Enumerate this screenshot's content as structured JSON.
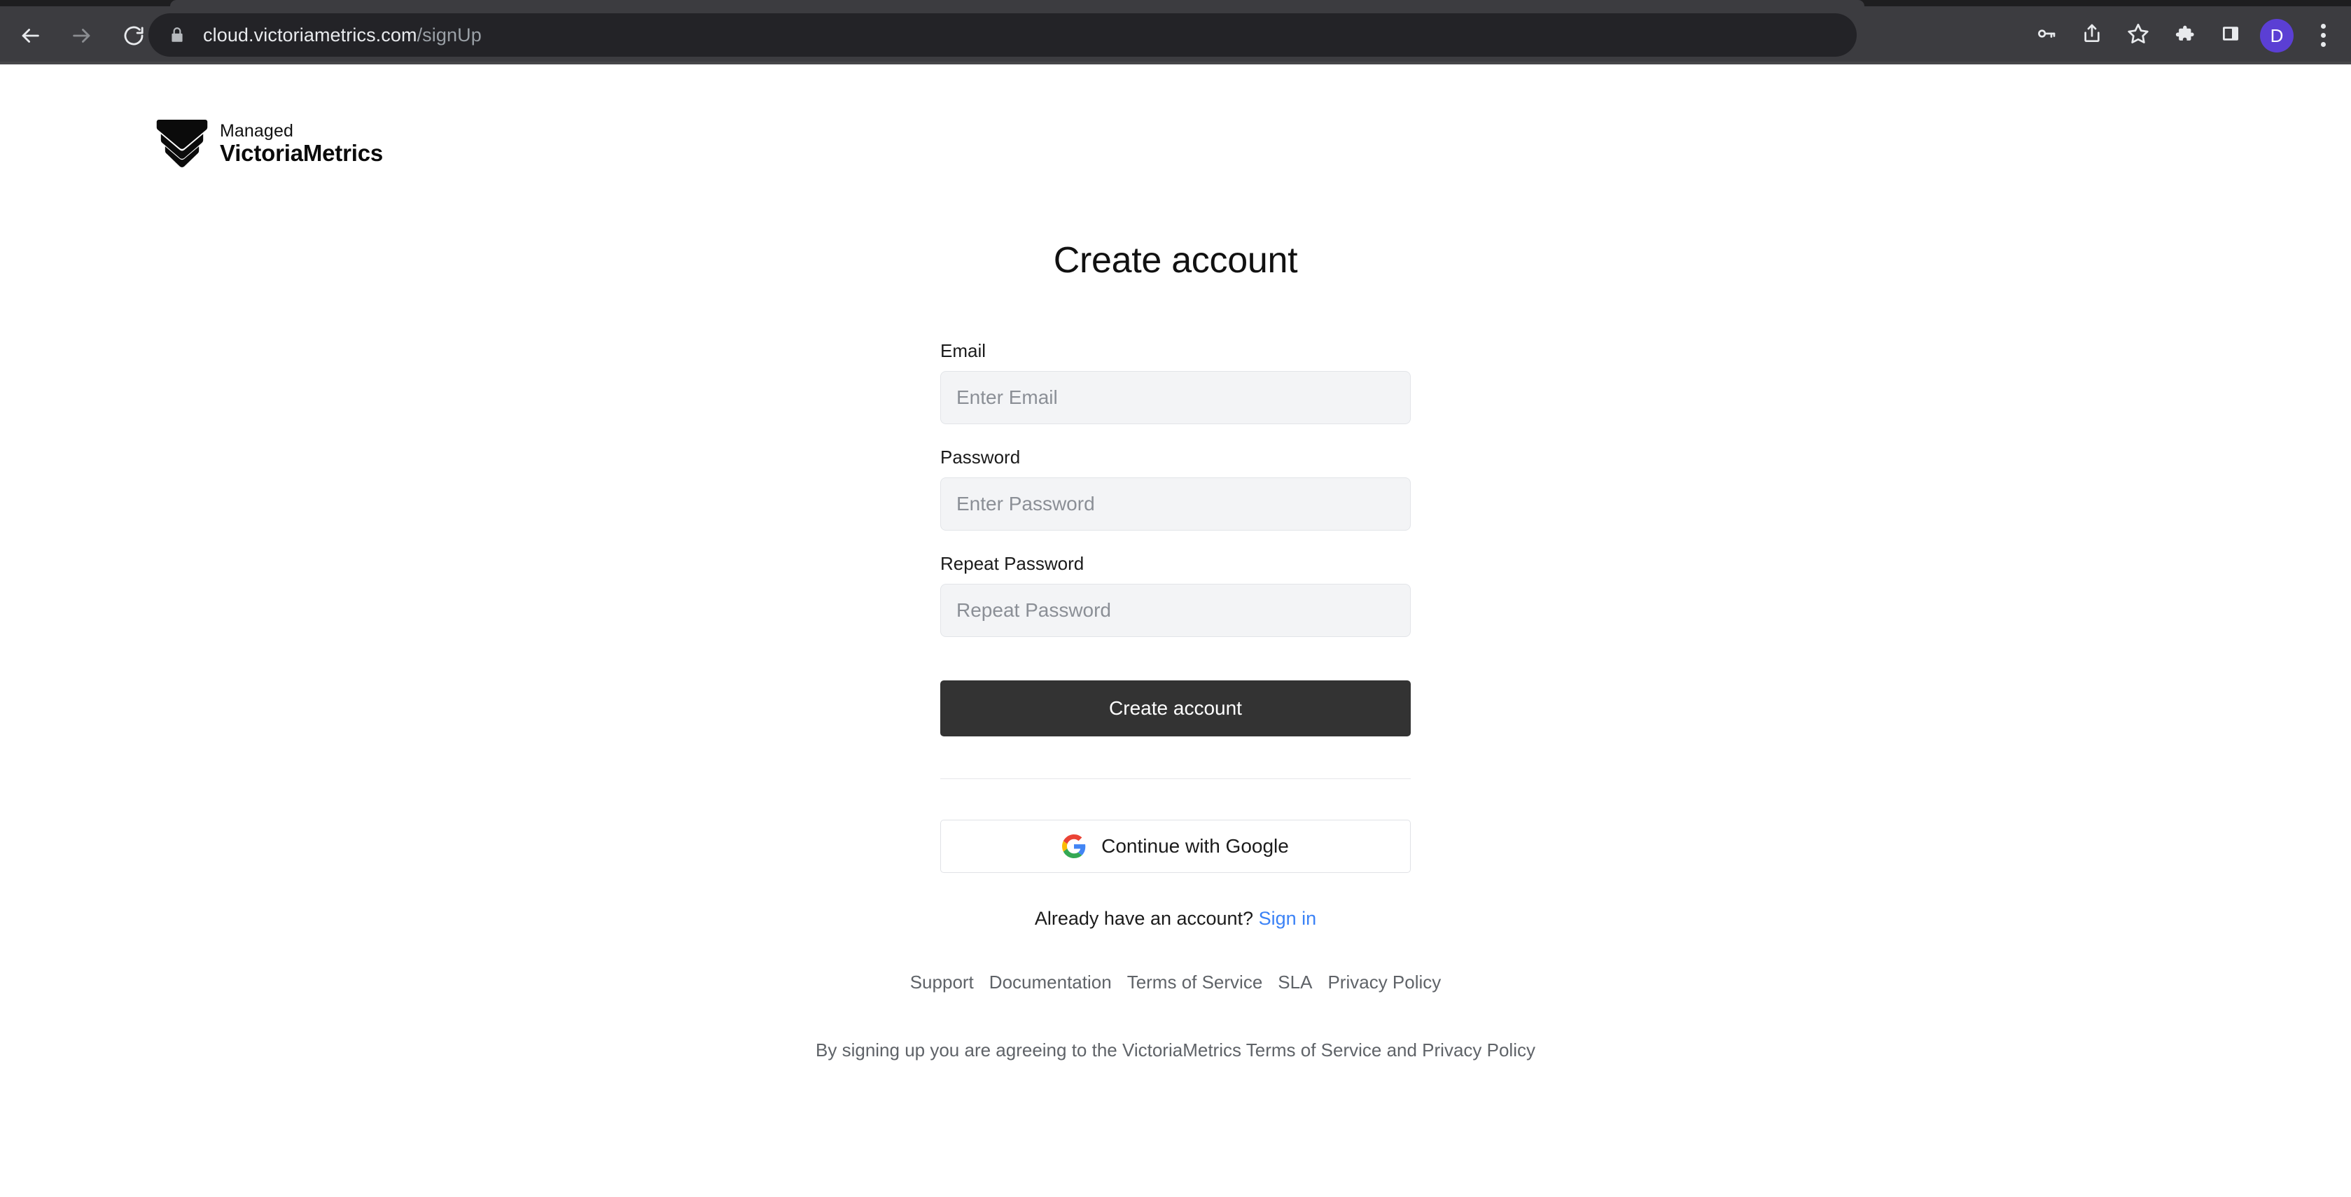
{
  "browser": {
    "back_icon": "back-arrow-icon",
    "forward_icon": "forward-arrow-icon",
    "reload_icon": "reload-icon",
    "lock_icon": "lock-icon",
    "url_host": "cloud.victoriametrics.com",
    "url_path": "/signUp",
    "actions": [
      {
        "name": "password-manager-icon",
        "label": "Passwords"
      },
      {
        "name": "share-icon",
        "label": "Share"
      },
      {
        "name": "bookmark-star-icon",
        "label": "Bookmark"
      },
      {
        "name": "extensions-puzzle-icon",
        "label": "Extensions"
      },
      {
        "name": "side-panel-icon",
        "label": "Side panel"
      }
    ],
    "avatar_initial": "D",
    "menu_icon": "three-dot-menu-icon",
    "colors": {
      "toolbar": "#3c3c40",
      "omnibox": "#232327",
      "tabstrip": "#1e1e20",
      "avatar": "#5b3fd4",
      "url_text": "#e8eaed",
      "url_path_text": "#9aa0a6"
    }
  },
  "brand": {
    "mark": "victoriametrics-chevron-logo",
    "line1": "Managed",
    "line2": "VictoriaMetrics"
  },
  "page": {
    "title": "Create account"
  },
  "form": {
    "email": {
      "label": "Email",
      "placeholder": "Enter Email",
      "value": ""
    },
    "password": {
      "label": "Password",
      "placeholder": "Enter Password",
      "value": ""
    },
    "repeat_password": {
      "label": "Repeat Password",
      "placeholder": "Repeat Password",
      "value": ""
    },
    "submit_label": "Create account",
    "google_label": "Continue with Google",
    "google_icon": "google-g-icon"
  },
  "signin": {
    "prompt": "Already have an account?",
    "link_label": "Sign in",
    "link_color": "#3b82f6"
  },
  "footer": {
    "links": [
      {
        "label": "Support"
      },
      {
        "label": "Documentation"
      },
      {
        "label": "Terms of Service"
      },
      {
        "label": "SLA"
      },
      {
        "label": "Privacy Policy"
      }
    ],
    "legal": "By signing up you are agreeing to the VictoriaMetrics Terms of Service and Privacy Policy"
  },
  "colors": {
    "primary_button": "#333333",
    "input_background": "#f3f4f6",
    "input_border": "#e2e4e8",
    "muted_text": "#5f6368",
    "page_background": "#ffffff"
  }
}
